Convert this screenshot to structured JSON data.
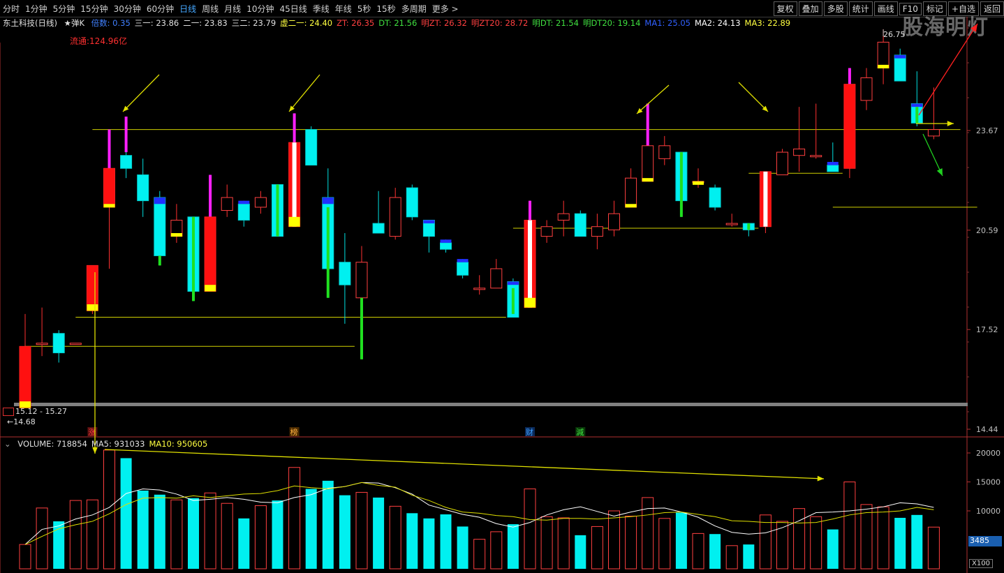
{
  "toolbar": {
    "periods": [
      "分时",
      "1分钟",
      "5分钟",
      "15分钟",
      "30分钟",
      "60分钟",
      "日线",
      "周线",
      "月线",
      "10分钟",
      "45日线",
      "季线",
      "年线",
      "5秒",
      "15秒",
      "多周期",
      "更多 >"
    ],
    "active_period": "日线",
    "tools": [
      "复权",
      "叠加",
      "多股",
      "统计",
      "画线",
      "F10",
      "标记",
      "+自选",
      "返回"
    ]
  },
  "info": {
    "stock": "东土科技(日线)",
    "mode": "★弹K",
    "items": [
      {
        "text": "倍数: 0.35",
        "color": "#4080ff"
      },
      {
        "text": "三一: 23.86",
        "color": "#e0e0e0"
      },
      {
        "text": "二一: 23.83",
        "color": "#e0e0e0"
      },
      {
        "text": "三二: 23.79",
        "color": "#e0e0e0"
      },
      {
        "text": "虚二一: 24.40",
        "color": "#ffff40"
      },
      {
        "text": "ZT: 26.35",
        "color": "#ff4040"
      },
      {
        "text": "DT: 21.56",
        "color": "#40e040"
      },
      {
        "text": "明ZT: 26.32",
        "color": "#ff4040"
      },
      {
        "text": "明ZT20: 28.72",
        "color": "#ff4040"
      },
      {
        "text": "明DT: 21.54",
        "color": "#40e040"
      },
      {
        "text": "明DT20: 19.14",
        "color": "#40e040"
      },
      {
        "text": "MA1: 25.05",
        "color": "#3060ff"
      },
      {
        "text": "MA2: 24.13",
        "color": "#ffffff"
      },
      {
        "text": "MA3: 22.89",
        "color": "#ffff40"
      }
    ],
    "float_cap": "流通:124.96亿"
  },
  "watermark": "股海明灯",
  "annotations": {
    "range": "15.12 - 15.27",
    "low": "14.68",
    "high": "26.75",
    "markers": [
      {
        "text": "涨",
        "index": 4,
        "color": "#ff4040",
        "bg": "#5a1010"
      },
      {
        "text": "榜",
        "index": 16,
        "color": "#ffb040",
        "bg": "#4a2a00"
      },
      {
        "text": "财",
        "index": 30,
        "color": "#40a0ff",
        "bg": "#0a2a5a"
      },
      {
        "text": "減",
        "index": 33,
        "color": "#40e040",
        "bg": "#0a3a0a"
      }
    ]
  },
  "volume": {
    "header": [
      {
        "text": "VOLUME: 718854",
        "color": "#e0e0e0"
      },
      {
        "text": "MA5: 931033",
        "color": "#e0e0e0"
      },
      {
        "text": "MA10: 950605",
        "color": "#ffff40"
      }
    ],
    "current_box": "3485",
    "unit": "X100"
  },
  "chart_data": {
    "type": "candlestick",
    "price_axis": {
      "ticks": [
        14.44,
        17.52,
        20.59,
        23.67
      ],
      "ylim": [
        14.2,
        27.5
      ]
    },
    "volume_axis": {
      "ticks": [
        10000,
        15000,
        20000
      ],
      "ylim": [
        0,
        21500
      ]
    },
    "candles": [
      {
        "o": 15.1,
        "c": 17.0,
        "h": 18.0,
        "l": 15.1,
        "type": "red",
        "v": 4200,
        "fx": [
          15.1,
          15.3
        ]
      },
      {
        "o": 17.1,
        "c": 17.1,
        "h": 18.2,
        "l": 16.7,
        "type": "hollow",
        "v": 10500
      },
      {
        "o": 16.8,
        "c": 17.4,
        "h": 17.5,
        "l": 16.5,
        "type": "cyan",
        "v": 8200
      },
      {
        "o": 17.1,
        "c": 17.1,
        "h": 17.1,
        "l": 17.1,
        "type": "hollow",
        "v": 11800
      },
      {
        "o": 18.1,
        "c": 19.5,
        "h": 19.5,
        "l": 18.0,
        "type": "red",
        "v": 11900,
        "fx": [
          18.1,
          18.3
        ]
      },
      {
        "o": 21.3,
        "c": 22.5,
        "h": 23.7,
        "l": 19.4,
        "type": "red",
        "v": 20500,
        "fx": [
          21.3,
          21.4
        ],
        "mx": [
          22.5,
          23.7
        ]
      },
      {
        "o": 22.9,
        "c": 22.5,
        "h": 23.3,
        "l": 22.2,
        "type": "cyan",
        "v": 19100,
        "mx": [
          23.0,
          24.1
        ]
      },
      {
        "o": 22.3,
        "c": 21.5,
        "h": 22.8,
        "l": 21.0,
        "type": "cyan",
        "v": 13500
      },
      {
        "o": 21.6,
        "c": 19.8,
        "h": 21.8,
        "l": 19.5,
        "type": "cyan",
        "v": 12800,
        "tip": [
          21.4,
          21.6
        ],
        "gx": [
          19.5,
          19.8
        ]
      },
      {
        "o": 20.4,
        "c": 20.9,
        "h": 21.4,
        "l": 20.2,
        "type": "hollow",
        "v": 11900,
        "fx": [
          20.4,
          20.5
        ]
      },
      {
        "o": 21.0,
        "c": 18.7,
        "h": 21.0,
        "l": 18.4,
        "type": "cyan",
        "v": 12200,
        "gx": [
          18.4,
          21.0
        ]
      },
      {
        "o": 18.7,
        "c": 21.0,
        "h": 22.3,
        "l": 18.7,
        "type": "red",
        "v": 13100,
        "fx": [
          18.7,
          18.9
        ],
        "mx": [
          21.0,
          22.3
        ]
      },
      {
        "o": 21.2,
        "c": 21.6,
        "h": 22.0,
        "l": 21.0,
        "type": "hollow",
        "v": 11300
      },
      {
        "o": 21.4,
        "c": 20.9,
        "h": 21.5,
        "l": 20.7,
        "type": "cyan",
        "v": 8700,
        "tip": [
          21.4,
          21.5
        ]
      },
      {
        "o": 21.3,
        "c": 21.6,
        "h": 21.8,
        "l": 21.1,
        "type": "hollow",
        "v": 10900
      },
      {
        "o": 22.0,
        "c": 20.4,
        "h": 22.0,
        "l": 20.4,
        "type": "cyan",
        "v": 11800,
        "gx": [
          20.4,
          22.0
        ]
      },
      {
        "o": 20.7,
        "c": 23.3,
        "h": 24.2,
        "l": 20.7,
        "type": "redwhite",
        "v": 17500,
        "fx": [
          20.7,
          21.0
        ],
        "mx": [
          23.3,
          24.2
        ]
      },
      {
        "o": 23.7,
        "c": 22.6,
        "h": 23.8,
        "l": 22.6,
        "type": "cyan",
        "v": 13800
      },
      {
        "o": 21.6,
        "c": 19.4,
        "h": 22.5,
        "l": 18.5,
        "type": "cyan",
        "v": 15200,
        "tip": [
          21.4,
          21.6
        ],
        "gx": [
          18.5,
          21.3
        ]
      },
      {
        "o": 19.6,
        "c": 18.9,
        "h": 20.5,
        "l": 17.7,
        "type": "cyan",
        "v": 12700
      },
      {
        "o": 19.6,
        "c": 18.5,
        "h": 20.1,
        "l": 16.6,
        "type": "hollow",
        "v": 13200,
        "gx": [
          16.6,
          18.5
        ]
      },
      {
        "o": 20.5,
        "c": 20.8,
        "h": 21.8,
        "l": 20.5,
        "type": "cyan",
        "v": 12300
      },
      {
        "o": 20.4,
        "c": 21.6,
        "h": 21.9,
        "l": 20.3,
        "type": "hollow",
        "v": 10800
      },
      {
        "o": 21.9,
        "c": 21.0,
        "h": 22.0,
        "l": 20.9,
        "type": "cyan",
        "v": 9600
      },
      {
        "o": 20.9,
        "c": 20.4,
        "h": 20.9,
        "l": 19.9,
        "type": "cyan",
        "v": 8700,
        "tip": [
          20.8,
          20.9
        ]
      },
      {
        "o": 20.2,
        "c": 20.0,
        "h": 20.3,
        "l": 19.9,
        "type": "cyan",
        "v": 9400,
        "tip": [
          20.2,
          20.3
        ]
      },
      {
        "o": 19.6,
        "c": 19.2,
        "h": 19.7,
        "l": 19.1,
        "type": "cyan",
        "v": 7300,
        "tip": [
          19.6,
          19.7
        ]
      },
      {
        "o": 18.8,
        "c": 18.8,
        "h": 19.2,
        "l": 18.6,
        "type": "hollow",
        "v": 5100
      },
      {
        "o": 18.8,
        "c": 19.4,
        "h": 19.7,
        "l": 18.8,
        "type": "hollow",
        "v": 6400
      },
      {
        "o": 19.0,
        "c": 17.9,
        "h": 19.1,
        "l": 17.9,
        "type": "cyan",
        "v": 7700,
        "tip": [
          18.9,
          19.0
        ],
        "gx": [
          18.0,
          18.8
        ]
      },
      {
        "o": 18.2,
        "c": 20.9,
        "h": 21.5,
        "l": 18.2,
        "type": "redwhite",
        "v": 13800,
        "fx": [
          18.2,
          18.5
        ],
        "mx": [
          20.9,
          21.5
        ]
      },
      {
        "o": 20.4,
        "c": 20.7,
        "h": 20.9,
        "l": 20.2,
        "type": "hollow",
        "v": 9000
      },
      {
        "o": 20.9,
        "c": 21.1,
        "h": 21.5,
        "l": 20.4,
        "type": "hollow",
        "v": 8800
      },
      {
        "o": 20.4,
        "c": 21.1,
        "h": 21.2,
        "l": 20.4,
        "type": "cyan",
        "v": 5800
      },
      {
        "o": 20.4,
        "c": 20.7,
        "h": 21.1,
        "l": 20.0,
        "type": "hollow",
        "v": 7300
      },
      {
        "o": 20.6,
        "c": 21.1,
        "h": 21.5,
        "l": 20.4,
        "type": "hollow",
        "v": 10000
      },
      {
        "o": 21.3,
        "c": 22.2,
        "h": 22.5,
        "l": 21.3,
        "type": "hollow",
        "v": 9100,
        "fx": [
          21.3,
          21.4
        ]
      },
      {
        "o": 22.1,
        "c": 23.2,
        "h": 24.5,
        "l": 22.1,
        "type": "hollow",
        "v": 12300,
        "fx": [
          22.1,
          22.2
        ],
        "mx": [
          23.2,
          24.5
        ]
      },
      {
        "o": 23.2,
        "c": 22.8,
        "h": 23.5,
        "l": 22.6,
        "type": "hollow",
        "v": 8700
      },
      {
        "o": 23.0,
        "c": 21.5,
        "h": 23.0,
        "l": 21.0,
        "type": "cyan",
        "v": 9700,
        "gx": [
          21.0,
          23.0
        ]
      },
      {
        "o": 22.1,
        "c": 22.1,
        "h": 22.5,
        "l": 21.9,
        "type": "hollow",
        "v": 6100,
        "fx": [
          22.05,
          22.1
        ]
      },
      {
        "o": 21.9,
        "c": 21.3,
        "h": 22.0,
        "l": 21.2,
        "type": "cyan",
        "v": 6000
      },
      {
        "o": 20.8,
        "c": 20.8,
        "h": 21.1,
        "l": 20.7,
        "type": "hollow",
        "v": 4000
      },
      {
        "o": 20.8,
        "c": 20.6,
        "h": 20.8,
        "l": 20.4,
        "type": "cyan",
        "v": 4200,
        "gx": [
          20.6,
          20.8
        ]
      },
      {
        "o": 20.7,
        "c": 22.4,
        "h": 22.4,
        "l": 20.5,
        "type": "redwhite",
        "v": 9300
      },
      {
        "o": 22.3,
        "c": 23.0,
        "h": 23.1,
        "l": 22.3,
        "type": "hollow",
        "v": 8200
      },
      {
        "o": 22.9,
        "c": 23.1,
        "h": 24.4,
        "l": 22.4,
        "type": "hollow",
        "v": 10400
      },
      {
        "o": 22.9,
        "c": 22.9,
        "h": 24.5,
        "l": 22.8,
        "type": "hollow",
        "v": 9000
      },
      {
        "o": 22.6,
        "c": 22.4,
        "h": 23.3,
        "l": 22.4,
        "type": "cyan",
        "v": 6800,
        "tip": [
          22.6,
          22.7
        ]
      },
      {
        "o": 22.5,
        "c": 25.1,
        "h": 25.6,
        "l": 22.2,
        "type": "red",
        "v": 15000,
        "mx": [
          25.1,
          25.6
        ]
      },
      {
        "o": 24.6,
        "c": 25.3,
        "h": 25.6,
        "l": 24.3,
        "type": "hollow",
        "v": 11100
      },
      {
        "o": 25.6,
        "c": 26.4,
        "h": 26.8,
        "l": 25.1,
        "type": "hollow",
        "v": 10700,
        "fx": [
          25.6,
          25.7
        ]
      },
      {
        "o": 26.0,
        "c": 25.2,
        "h": 26.2,
        "l": 25.2,
        "type": "cyan",
        "v": 8800,
        "tip": [
          25.9,
          26.0
        ]
      },
      {
        "o": 24.5,
        "c": 23.9,
        "h": 25.5,
        "l": 23.8,
        "type": "cyan",
        "v": 9300,
        "tip": [
          24.4,
          24.5
        ],
        "gx": [
          23.9,
          24.4
        ]
      },
      {
        "o": 23.7,
        "c": 23.5,
        "h": 25.0,
        "l": 23.4,
        "type": "hollow",
        "v": 7200
      }
    ],
    "ma_volume_5": [
      4200,
      6800,
      7400,
      8600,
      9300,
      10600,
      13000,
      13800,
      13600,
      12900,
      11800,
      12000,
      12300,
      12000,
      11500,
      11400,
      12300,
      12800,
      13900,
      14200,
      14900,
      14800,
      14000,
      12900,
      11000,
      10200,
      9400,
      8900,
      7800,
      7200,
      8000,
      9300,
      10200,
      10700,
      9900,
      9100,
      9800,
      10400,
      10500,
      9800,
      8900,
      7400,
      6300,
      6000,
      6200,
      7100,
      8300,
      9700,
      9800,
      10000,
      10300,
      10700,
      11400,
      11200,
      10600
    ],
    "ma_volume_10": [
      4200,
      5600,
      6900,
      7600,
      8200,
      9500,
      11100,
      12200,
      12300,
      12200,
      12600,
      12300,
      12600,
      12900,
      13000,
      13500,
      14300,
      14000,
      13800,
      14200,
      14900,
      14400,
      14100,
      12700,
      11800,
      10600,
      9800,
      9600,
      9200,
      9000,
      8500,
      8400,
      8700,
      8700,
      8600,
      8800,
      9000,
      9300,
      9700,
      9800,
      9400,
      9000,
      8300,
      8200,
      8000,
      8000,
      7900,
      8000,
      8600,
      9300,
      9700,
      9800,
      10000,
      10600,
      10200
    ]
  }
}
